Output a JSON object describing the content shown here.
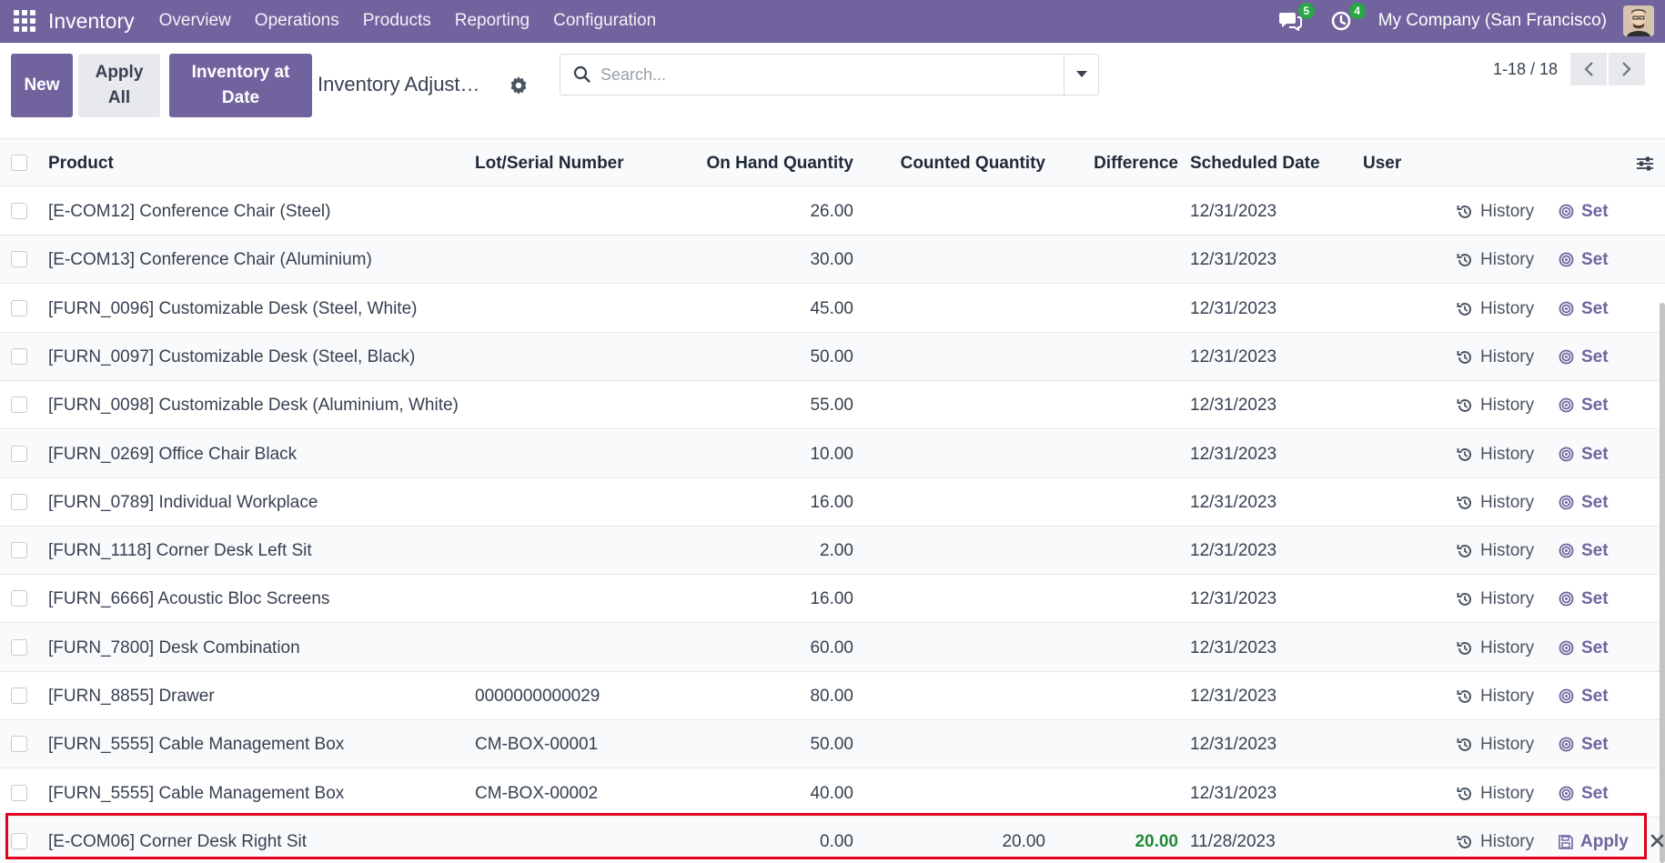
{
  "navbar": {
    "app_name": "Inventory",
    "menu": [
      "Overview",
      "Operations",
      "Products",
      "Reporting",
      "Configuration"
    ],
    "messages_count": "5",
    "activities_count": "4",
    "company": "My Company (San Francisco)"
  },
  "control_panel": {
    "new_label": "New",
    "apply_all_label": "Apply All",
    "inventory_at_date_label": "Inventory at Date",
    "breadcrumb": "Inventory Adjust…",
    "search_placeholder": "Search...",
    "pager": "1-18 / 18"
  },
  "table": {
    "columns": [
      "Product",
      "Lot/Serial Number",
      "On Hand Quantity",
      "Counted Quantity",
      "Difference",
      "Scheduled Date",
      "User"
    ],
    "history_label": "History",
    "set_label": "Set",
    "apply_label": "Apply",
    "rows": [
      {
        "product": "[E-COM12] Conference Chair (Steel)",
        "lot": "",
        "on_hand": "26.00",
        "counted": "",
        "difference": "",
        "date": "12/31/2023",
        "user": ""
      },
      {
        "product": "[E-COM13] Conference Chair (Aluminium)",
        "lot": "",
        "on_hand": "30.00",
        "counted": "",
        "difference": "",
        "date": "12/31/2023",
        "user": ""
      },
      {
        "product": "[FURN_0096] Customizable Desk (Steel, White)",
        "lot": "",
        "on_hand": "45.00",
        "counted": "",
        "difference": "",
        "date": "12/31/2023",
        "user": ""
      },
      {
        "product": "[FURN_0097] Customizable Desk (Steel, Black)",
        "lot": "",
        "on_hand": "50.00",
        "counted": "",
        "difference": "",
        "date": "12/31/2023",
        "user": ""
      },
      {
        "product": "[FURN_0098] Customizable Desk (Aluminium, White)",
        "lot": "",
        "on_hand": "55.00",
        "counted": "",
        "difference": "",
        "date": "12/31/2023",
        "user": ""
      },
      {
        "product": "[FURN_0269] Office Chair Black",
        "lot": "",
        "on_hand": "10.00",
        "counted": "",
        "difference": "",
        "date": "12/31/2023",
        "user": ""
      },
      {
        "product": "[FURN_0789] Individual Workplace",
        "lot": "",
        "on_hand": "16.00",
        "counted": "",
        "difference": "",
        "date": "12/31/2023",
        "user": ""
      },
      {
        "product": "[FURN_1118] Corner Desk Left Sit",
        "lot": "",
        "on_hand": "2.00",
        "counted": "",
        "difference": "",
        "date": "12/31/2023",
        "user": ""
      },
      {
        "product": "[FURN_6666] Acoustic Bloc Screens",
        "lot": "",
        "on_hand": "16.00",
        "counted": "",
        "difference": "",
        "date": "12/31/2023",
        "user": ""
      },
      {
        "product": "[FURN_7800] Desk Combination",
        "lot": "",
        "on_hand": "60.00",
        "counted": "",
        "difference": "",
        "date": "12/31/2023",
        "user": ""
      },
      {
        "product": "[FURN_8855] Drawer",
        "lot": "0000000000029",
        "on_hand": "80.00",
        "counted": "",
        "difference": "",
        "date": "12/31/2023",
        "user": ""
      },
      {
        "product": "[FURN_5555] Cable Management Box",
        "lot": "CM-BOX-00001",
        "on_hand": "50.00",
        "counted": "",
        "difference": "",
        "date": "12/31/2023",
        "user": ""
      },
      {
        "product": "[FURN_5555] Cable Management Box",
        "lot": "CM-BOX-00002",
        "on_hand": "40.00",
        "counted": "",
        "difference": "",
        "date": "12/31/2023",
        "user": ""
      },
      {
        "product": "[E-COM06] Corner Desk Right Sit",
        "lot": "",
        "on_hand": "0.00",
        "counted": "20.00",
        "difference": "20.00",
        "date": "11/28/2023",
        "user": ""
      }
    ]
  },
  "colors": {
    "brand": "#71639e",
    "badge_green": "#28a745",
    "difference_positive": "#1f8a34",
    "highlight_red": "#e3001b"
  }
}
